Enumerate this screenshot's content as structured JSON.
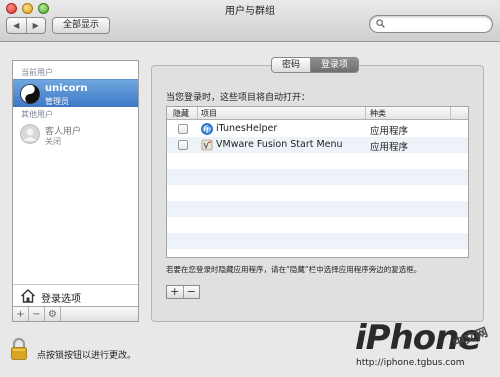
{
  "window": {
    "title": "用户与群组"
  },
  "toolbar": {
    "back_label": "◀",
    "forward_label": "▶",
    "show_all_label": "全部显示",
    "search_value": ""
  },
  "sidebar": {
    "current_users_header": "当前用户",
    "current_user": {
      "name": "unicorn",
      "role": "管理员"
    },
    "other_users_header": "其他用户",
    "guest_user": {
      "name": "客人用户",
      "status": "关闭"
    },
    "login_options_label": "登录选项",
    "add_label": "+",
    "remove_label": "−",
    "settings_label": "⚙"
  },
  "tabs": [
    {
      "label": "密码",
      "active": false
    },
    {
      "label": "登录项",
      "active": true
    }
  ],
  "login_items": {
    "heading": "当您登录时，这些项目将自动打开：",
    "columns": {
      "hide": "隐藏",
      "item": "项目",
      "kind": "种类"
    },
    "rows": [
      {
        "name": "iTunesHelper",
        "kind": "应用程序",
        "hidden": false,
        "icon": "itunes-helper-icon"
      },
      {
        "name": "VMware Fusion Start Menu",
        "kind": "应用程序",
        "hidden": false,
        "icon": "vmware-icon"
      }
    ],
    "footnote": "若要在您登录时隐藏应用程序，请在“隐藏”栏中选择应用程序旁边的复选框。",
    "add_label": "+",
    "remove_label": "−"
  },
  "lock": {
    "label": "点按锁按钮以进行更改。"
  },
  "watermark": {
    "brand": "iPhone",
    "cn": "中文网",
    "url": "http://iphone.tgbus.com"
  },
  "colors": {
    "selection": "#3d78c6",
    "panel_bg": "#e0e0e0",
    "alt_row": "#eef3fa"
  }
}
